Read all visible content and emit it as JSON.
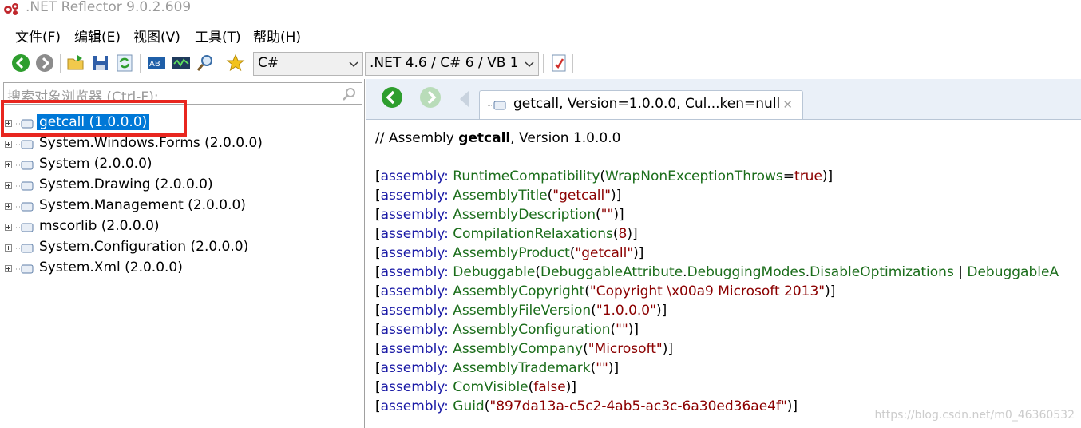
{
  "window": {
    "title": ".NET Reflector 9.0.2.609",
    "icon": "reflector-gears-icon"
  },
  "menu": [
    {
      "label": "文件(F)"
    },
    {
      "label": "编辑(E)"
    },
    {
      "label": "视图(V)"
    },
    {
      "label": "工具(T)"
    },
    {
      "label": "帮助(H)"
    }
  ],
  "toolbar": {
    "buttons": [
      "back-icon",
      "forward-icon",
      "open-icon",
      "save-icon",
      "refresh-icon",
      "analyzer-icon",
      "disassembler-icon",
      "search-icon",
      "bookmark-star-icon",
      "options-icon"
    ],
    "language_combo": "C#",
    "framework_combo": ".NET 4.6 / C# 6 / VB 1"
  },
  "search": {
    "placeholder": "搜索对象浏览器 (Ctrl-F):"
  },
  "tree": [
    {
      "label": "getcall (1.0.0.0)",
      "selected": true
    },
    {
      "label": "System.Windows.Forms (2.0.0.0)"
    },
    {
      "label": "System (2.0.0.0)"
    },
    {
      "label": "System.Drawing (2.0.0.0)"
    },
    {
      "label": "System.Management (2.0.0.0)"
    },
    {
      "label": "mscorlib (2.0.0.0)"
    },
    {
      "label": "System.Configuration (2.0.0.0)"
    },
    {
      "label": "System.Xml (2.0.0.0)"
    }
  ],
  "document_tab": {
    "label": "getcall, Version=1.0.0.0, Cul...ken=null",
    "close": "✕"
  },
  "code": {
    "header_prefix": "// Assembly ",
    "header_name": "getcall",
    "header_suffix": ", Version 1.0.0.0",
    "lines": [
      [
        "[",
        "assembly:",
        " ",
        "RuntimeCompatibility",
        "(",
        "WrapNonExceptionThrows",
        "=",
        "true",
        ")]"
      ],
      [
        "[",
        "assembly:",
        " ",
        "AssemblyTitle",
        "(",
        "\"getcall\"",
        ")]"
      ],
      [
        "[",
        "assembly:",
        " ",
        "AssemblyDescription",
        "(",
        "\"\"",
        ")]"
      ],
      [
        "[",
        "assembly:",
        " ",
        "CompilationRelaxations",
        "(",
        "8",
        ")]"
      ],
      [
        "[",
        "assembly:",
        " ",
        "AssemblyProduct",
        "(",
        "\"getcall\"",
        ")]"
      ],
      [
        "[",
        "assembly:",
        " ",
        "Debuggable",
        "(",
        "DebuggableAttribute",
        ".",
        "DebuggingModes",
        ".",
        "DisableOptimizations",
        " | ",
        "DebuggableA"
      ],
      [
        "[",
        "assembly:",
        " ",
        "AssemblyCopyright",
        "(",
        "\"Copyright \\x00a9 Microsoft 2013\"",
        ")]"
      ],
      [
        "[",
        "assembly:",
        " ",
        "AssemblyFileVersion",
        "(",
        "\"1.0.0.0\"",
        ")]"
      ],
      [
        "[",
        "assembly:",
        " ",
        "AssemblyConfiguration",
        "(",
        "\"\"",
        ")]"
      ],
      [
        "[",
        "assembly:",
        " ",
        "AssemblyCompany",
        "(",
        "\"Microsoft\"",
        ")]"
      ],
      [
        "[",
        "assembly:",
        " ",
        "AssemblyTrademark",
        "(",
        "\"\"",
        ")]"
      ],
      [
        "[",
        "assembly:",
        " ",
        "ComVisible",
        "(",
        "false",
        ")]"
      ],
      [
        "[",
        "assembly:",
        " ",
        "Guid",
        "(",
        "\"897da13a-c5c2-4ab5-ac3c-6a30ed36ae4f\"",
        ")]"
      ]
    ],
    "token_kinds": [
      [
        "plain",
        "kw",
        "plain",
        "attr",
        "plain",
        "attr",
        "plain",
        "str",
        "plain"
      ],
      [
        "plain",
        "kw",
        "plain",
        "attr",
        "plain",
        "str",
        "plain"
      ],
      [
        "plain",
        "kw",
        "plain",
        "attr",
        "plain",
        "str",
        "plain"
      ],
      [
        "plain",
        "kw",
        "plain",
        "attr",
        "plain",
        "num",
        "plain"
      ],
      [
        "plain",
        "kw",
        "plain",
        "attr",
        "plain",
        "str",
        "plain"
      ],
      [
        "plain",
        "kw",
        "plain",
        "attr",
        "plain",
        "attr",
        "plain",
        "attr",
        "plain",
        "attr",
        "plain",
        "attr"
      ],
      [
        "plain",
        "kw",
        "plain",
        "attr",
        "plain",
        "str",
        "plain"
      ],
      [
        "plain",
        "kw",
        "plain",
        "attr",
        "plain",
        "str",
        "plain"
      ],
      [
        "plain",
        "kw",
        "plain",
        "attr",
        "plain",
        "str",
        "plain"
      ],
      [
        "plain",
        "kw",
        "plain",
        "attr",
        "plain",
        "str",
        "plain"
      ],
      [
        "plain",
        "kw",
        "plain",
        "attr",
        "plain",
        "str",
        "plain"
      ],
      [
        "plain",
        "kw",
        "plain",
        "attr",
        "plain",
        "str",
        "plain"
      ],
      [
        "plain",
        "kw",
        "plain",
        "attr",
        "plain",
        "str",
        "plain"
      ]
    ]
  },
  "watermark": "https://blog.csdn.net/m0_46360532",
  "colors": {
    "selection": "#0078d7",
    "highlight_box": "#e8261f",
    "keyword": "#1a1aa6",
    "attribute": "#1b6d1b",
    "string": "#8b0000"
  }
}
